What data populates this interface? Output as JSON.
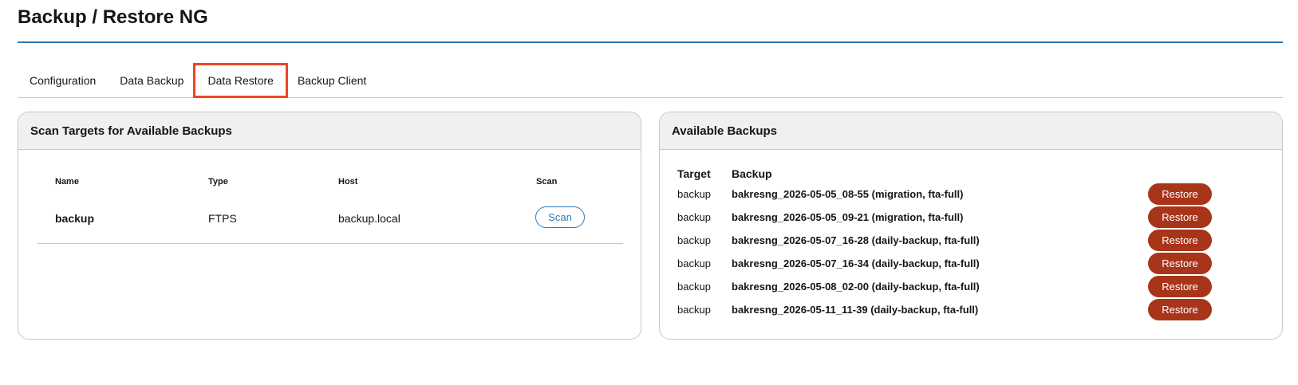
{
  "page": {
    "title": "Backup / Restore NG"
  },
  "tabs": [
    {
      "label": "Configuration",
      "active": false
    },
    {
      "label": "Data Backup",
      "active": false
    },
    {
      "label": "Data Restore",
      "active": true
    },
    {
      "label": "Backup Client",
      "active": false
    }
  ],
  "scan_panel": {
    "title": "Scan Targets for Available Backups",
    "columns": {
      "name": "Name",
      "type": "Type",
      "host": "Host",
      "scan": "Scan"
    },
    "rows": [
      {
        "name": "backup",
        "type": "FTPS",
        "host": "backup.local",
        "scan_label": "Scan"
      }
    ]
  },
  "backups_panel": {
    "title": "Available Backups",
    "columns": {
      "target": "Target",
      "backup": "Backup"
    },
    "restore_label": "Restore",
    "rows": [
      {
        "target": "backup",
        "name": "bakresng_2026-05-05_08-55 (migration, fta-full)"
      },
      {
        "target": "backup",
        "name": "bakresng_2026-05-05_09-21 (migration, fta-full)"
      },
      {
        "target": "backup",
        "name": "bakresng_2026-05-07_16-28 (daily-backup, fta-full)"
      },
      {
        "target": "backup",
        "name": "bakresng_2026-05-07_16-34 (daily-backup, fta-full)"
      },
      {
        "target": "backup",
        "name": "bakresng_2026-05-08_02-00 (daily-backup, fta-full)"
      },
      {
        "target": "backup",
        "name": "bakresng_2026-05-11_11-39 (daily-backup, fta-full)"
      }
    ]
  },
  "colors": {
    "accent": "#2b7bb9",
    "restore": "#a8341a",
    "active_tab_outline": "#ee4622"
  }
}
